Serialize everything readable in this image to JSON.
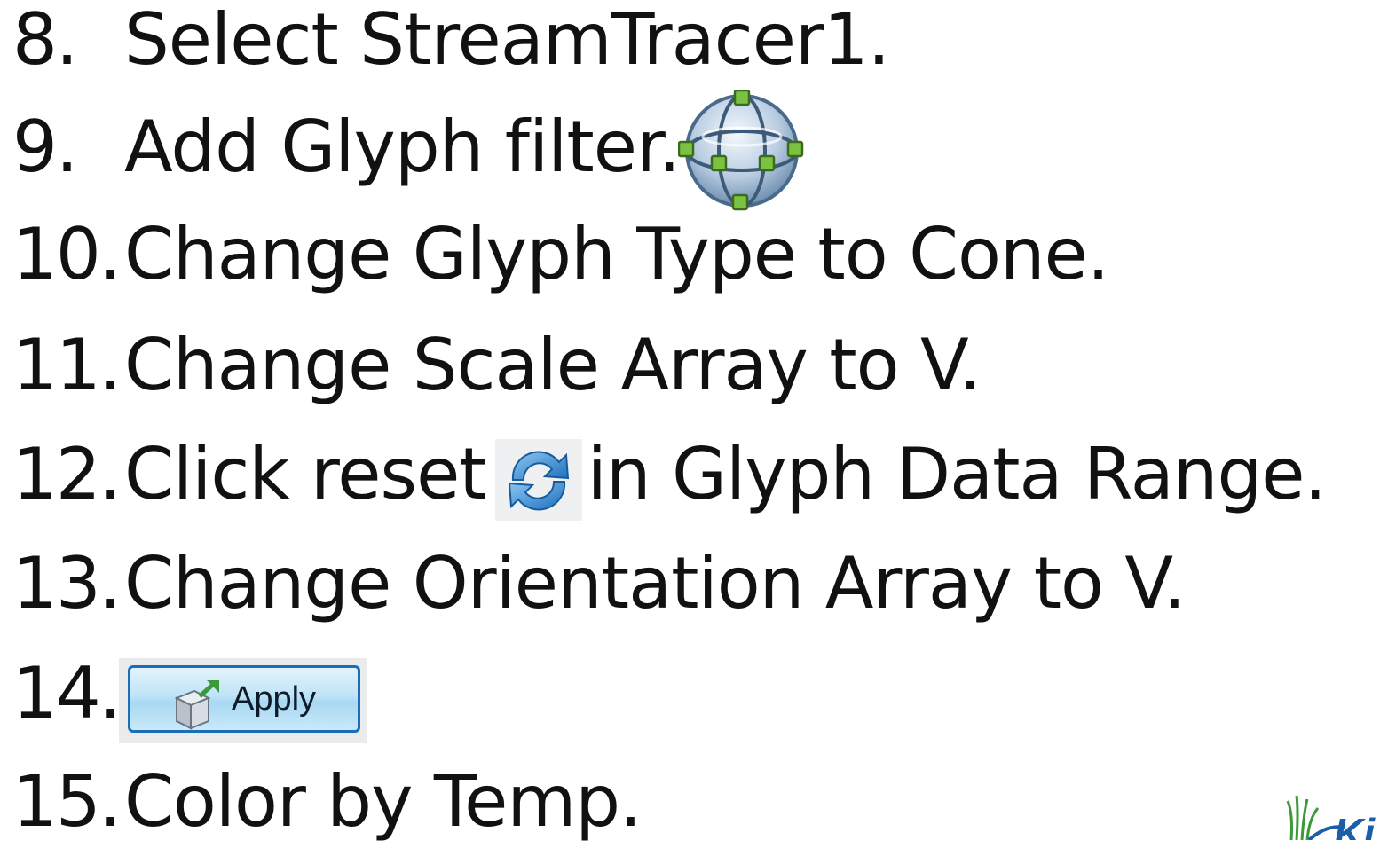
{
  "steps": [
    {
      "number": "8.",
      "text": "Select StreamTracer1."
    },
    {
      "number": "9.",
      "text": "Add Glyph filter."
    },
    {
      "number": "10.",
      "text": "Change Glyph Type to Cone."
    },
    {
      "number": "11.",
      "text": "Change Scale Array to V."
    },
    {
      "number": "12.",
      "text_before": "Click reset",
      "text_after": "in Glyph Data Range."
    },
    {
      "number": "13.",
      "text": "Change Orientation Array to V."
    },
    {
      "number": "14.",
      "button_label": "Apply"
    },
    {
      "number": "15.",
      "text": "Color by Temp."
    }
  ],
  "icons": {
    "glyph_filter": "glyph-filter-icon",
    "reset": "reset-range-icon",
    "apply": "apply-cube-icon",
    "logo": "kitware-logo"
  },
  "logo_text": "Ki",
  "colors": {
    "text": "#111111",
    "apply_border": "#1a6fb8",
    "apply_fill": "#bfe3f7",
    "reset_blue": "#2f86d1",
    "glyph_green": "#7cc242",
    "logo_green": "#3a9a3a",
    "logo_blue": "#1b5fa8"
  }
}
